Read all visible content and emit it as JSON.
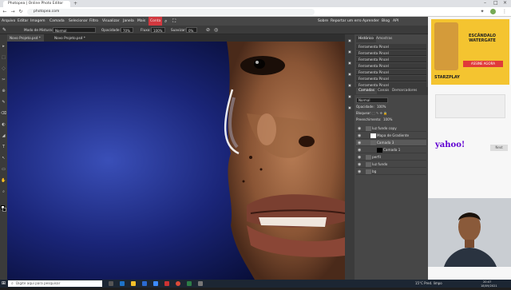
{
  "browser": {
    "tab_title": "Photopea | Online Photo Editor",
    "url": "photopea.com"
  },
  "menubar": {
    "items": [
      "Arquivo",
      "Editar",
      "Imagem",
      "Camada",
      "Selecionar",
      "Filtro",
      "Visualizar",
      "Janela",
      "Mais",
      "Conta"
    ],
    "active": "Conta",
    "right_items": [
      "Sobre",
      "Reportar um erro",
      "Aprender",
      "Blog",
      "API"
    ]
  },
  "options": {
    "blend_label": "Modo de Mistura:",
    "blend_value": "Normal",
    "opacity_label": "Opacidade:",
    "opacity_value": "70%",
    "flow_label": "Fluxo:",
    "flow_value": "100%",
    "smooth_label": "Suavizar:",
    "smooth_value": "0%"
  },
  "doc_tabs": [
    "Novo Projeto.psd *",
    "Novo Projeto.psd *"
  ],
  "history_panel": {
    "tabs": [
      "Histórico",
      "Amostras"
    ],
    "items": [
      "Ferramenta Pincel",
      "Ferramenta Pincel",
      "Ferramenta Pincel",
      "Ferramenta Pincel",
      "Ferramenta Pincel",
      "Ferramenta Pincel",
      "Ferramenta Pincel"
    ]
  },
  "layers_panel": {
    "tabs": [
      "Camadas",
      "Canais",
      "Demarcadores"
    ],
    "blend": "Normal",
    "opacity_label": "Opacidade:",
    "opacity_value": "100%",
    "lock_label": "Bloquear:",
    "fill_label": "Preenchimento:",
    "fill_value": "100%",
    "layers": [
      "luz fundo copy",
      "Mapa de Gradiente",
      "Camada 3",
      "Camada 1",
      "perfil",
      "luz fundo",
      "bg"
    ]
  },
  "side_icons": [
    "inf",
    "css",
    "props",
    "brush",
    "char",
    "para",
    "layers"
  ],
  "webpage": {
    "ad_text": "ESCÂNDALO WATERGATE",
    "ad_brand": "STARZPLAY",
    "ad_cta": "ASSINE AGORA",
    "yahoo": "yahoo!",
    "placeholder_text": "Next"
  },
  "taskbar": {
    "search_placeholder": "Digite aqui para pesquisar",
    "weather": "15°C  Pred. limpo",
    "time": "20:47",
    "date": "18/09/2021"
  },
  "colors": {
    "accent": "#d2383f",
    "panel": "#474747",
    "toolbar": "#3b3b3b",
    "ad": "#f4c430"
  }
}
